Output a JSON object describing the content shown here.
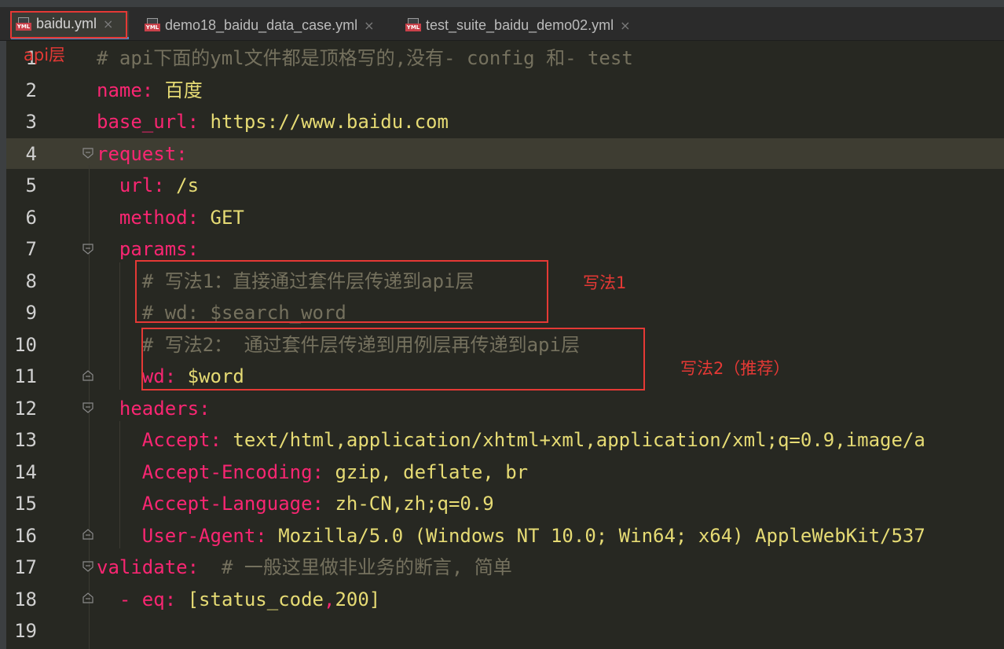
{
  "tabs": [
    {
      "label": "baidu.yml",
      "icon": "yml-file-icon",
      "active": true
    },
    {
      "label": "demo18_baidu_data_case.yml",
      "icon": "yml-file-icon",
      "active": false
    },
    {
      "label": "test_suite_baidu_demo02.yml",
      "icon": "yml-file-icon",
      "active": false
    }
  ],
  "yml_tag": "YML",
  "close_glyph": "×",
  "lines": [
    {
      "n": "1",
      "parts": [
        [
          "cmt",
          "# api下面的yml文件都是顶格写的,没有- config 和- test"
        ]
      ]
    },
    {
      "n": "2",
      "parts": [
        [
          "key",
          "name"
        ],
        [
          "punct",
          ": "
        ],
        [
          "val",
          "百度"
        ]
      ]
    },
    {
      "n": "3",
      "parts": [
        [
          "key",
          "base_url"
        ],
        [
          "punct",
          ": "
        ],
        [
          "val",
          "https://www.baidu.com"
        ]
      ]
    },
    {
      "n": "4",
      "parts": [
        [
          "key",
          "request"
        ],
        [
          "punct",
          ":"
        ]
      ]
    },
    {
      "n": "5",
      "parts": [
        [
          "plain",
          "  "
        ],
        [
          "key",
          "url"
        ],
        [
          "punct",
          ": "
        ],
        [
          "val",
          "/s"
        ]
      ]
    },
    {
      "n": "6",
      "parts": [
        [
          "plain",
          "  "
        ],
        [
          "key",
          "method"
        ],
        [
          "punct",
          ": "
        ],
        [
          "val",
          "GET"
        ]
      ]
    },
    {
      "n": "7",
      "parts": [
        [
          "plain",
          "  "
        ],
        [
          "key",
          "params"
        ],
        [
          "punct",
          ":"
        ]
      ]
    },
    {
      "n": "8",
      "parts": [
        [
          "plain",
          "    "
        ],
        [
          "cmt",
          "# 写法1：直接通过套件层传递到api层"
        ]
      ]
    },
    {
      "n": "9",
      "parts": [
        [
          "plain",
          "    "
        ],
        [
          "cmt",
          "# wd: $search_word"
        ]
      ]
    },
    {
      "n": "10",
      "parts": [
        [
          "plain",
          "    "
        ],
        [
          "cmt",
          "# 写法2： 通过套件层传递到用例层再传递到api层"
        ]
      ]
    },
    {
      "n": "11",
      "parts": [
        [
          "plain",
          "    "
        ],
        [
          "key",
          "wd"
        ],
        [
          "punct",
          ": "
        ],
        [
          "val",
          "$word"
        ]
      ]
    },
    {
      "n": "12",
      "parts": [
        [
          "plain",
          "  "
        ],
        [
          "key",
          "headers"
        ],
        [
          "punct",
          ":"
        ]
      ]
    },
    {
      "n": "13",
      "parts": [
        [
          "plain",
          "    "
        ],
        [
          "key",
          "Accept"
        ],
        [
          "punct",
          ": "
        ],
        [
          "val",
          "text/html,application/xhtml+xml,application/xml;q=0.9,image/a"
        ]
      ]
    },
    {
      "n": "14",
      "parts": [
        [
          "plain",
          "    "
        ],
        [
          "key",
          "Accept-Encoding"
        ],
        [
          "punct",
          ": "
        ],
        [
          "val",
          "gzip, deflate, br"
        ]
      ]
    },
    {
      "n": "15",
      "parts": [
        [
          "plain",
          "    "
        ],
        [
          "key",
          "Accept-Language"
        ],
        [
          "punct",
          ": "
        ],
        [
          "val",
          "zh-CN,zh;q=0.9"
        ]
      ]
    },
    {
      "n": "16",
      "parts": [
        [
          "plain",
          "    "
        ],
        [
          "key",
          "User-Agent"
        ],
        [
          "punct",
          ": "
        ],
        [
          "val",
          "Mozilla/5.0 (Windows NT 10.0; Win64; x64) AppleWebKit/537"
        ]
      ]
    },
    {
      "n": "17",
      "parts": [
        [
          "key",
          "validate"
        ],
        [
          "punct",
          ":  "
        ],
        [
          "cmt",
          "# 一般这里做非业务的断言, 简单"
        ]
      ]
    },
    {
      "n": "18",
      "parts": [
        [
          "plain",
          "  "
        ],
        [
          "key",
          "- eq"
        ],
        [
          "punct",
          ": "
        ],
        [
          "val",
          "[status_code"
        ],
        [
          "punct",
          ","
        ],
        [
          "val",
          "200]"
        ]
      ]
    },
    {
      "n": "19",
      "parts": []
    }
  ],
  "annotations": {
    "api_layer": "api层",
    "method1": "写法1",
    "method2": "写法2（推荐）"
  },
  "colors": {
    "annotation": "#e53935",
    "key": "#f92672",
    "value": "#e6db74",
    "comment": "#75715e",
    "background": "#272822"
  }
}
